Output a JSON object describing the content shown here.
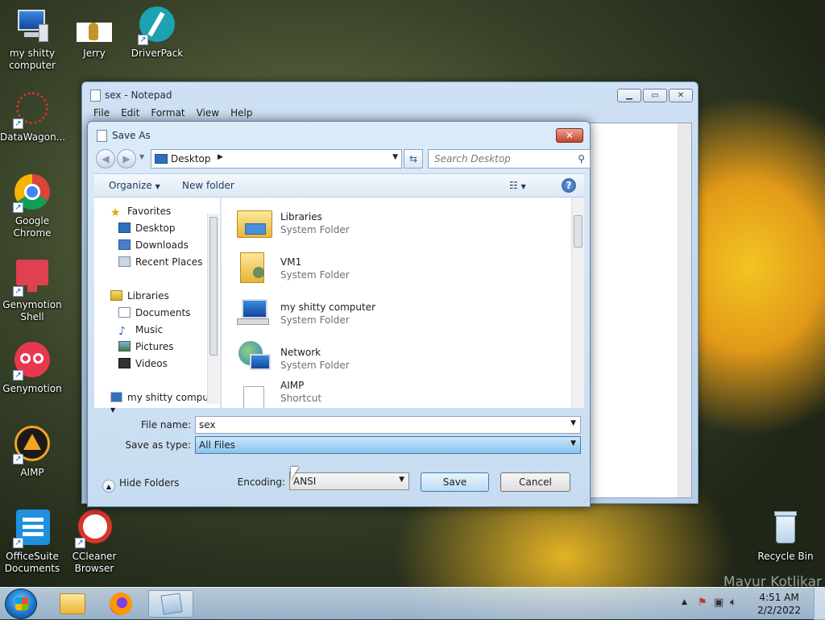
{
  "desktop": {
    "icons": [
      {
        "label": "my shitty computer"
      },
      {
        "label": "Jerry"
      },
      {
        "label": "DriverPack"
      },
      {
        "label": "DataWagon..."
      },
      {
        "label": "Google Chrome"
      },
      {
        "label": "Genymotion Shell"
      },
      {
        "label": "Genymotion"
      },
      {
        "label": "AIMP"
      },
      {
        "label": "OfficeSuite Documents"
      },
      {
        "label": "CCleaner Browser"
      },
      {
        "label": "Recycle Bin"
      }
    ],
    "watermark": "Mayur Kotlikar"
  },
  "notepad": {
    "title": "sex - Notepad",
    "menu": [
      "File",
      "Edit",
      "Format",
      "View",
      "Help"
    ]
  },
  "dialog": {
    "title": "Save As",
    "address": "Desktop",
    "search_placeholder": "Search Desktop",
    "toolbar": {
      "organize": "Organize",
      "new_folder": "New folder"
    },
    "nav": {
      "favorites": "Favorites",
      "desktop": "Desktop",
      "downloads": "Downloads",
      "recent": "Recent Places",
      "libraries": "Libraries",
      "documents": "Documents",
      "music": "Music",
      "pictures": "Pictures",
      "videos": "Videos",
      "computer": "my shitty compute"
    },
    "files": [
      {
        "name": "Libraries",
        "type": "System Folder"
      },
      {
        "name": "VM1",
        "type": "System Folder"
      },
      {
        "name": "my shitty computer",
        "type": "System Folder"
      },
      {
        "name": "Network",
        "type": "System Folder"
      },
      {
        "name": "AIMP",
        "type": "Shortcut"
      }
    ],
    "file_name_label": "File name:",
    "file_name_value": "sex",
    "save_type_label": "Save as type:",
    "save_type_value": "All Files",
    "hide_folders": "Hide Folders",
    "encoding_label": "Encoding:",
    "encoding_value": "ANSI",
    "save": "Save",
    "cancel": "Cancel"
  },
  "taskbar": {
    "time": "4:51 AM",
    "date": "2/2/2022"
  }
}
